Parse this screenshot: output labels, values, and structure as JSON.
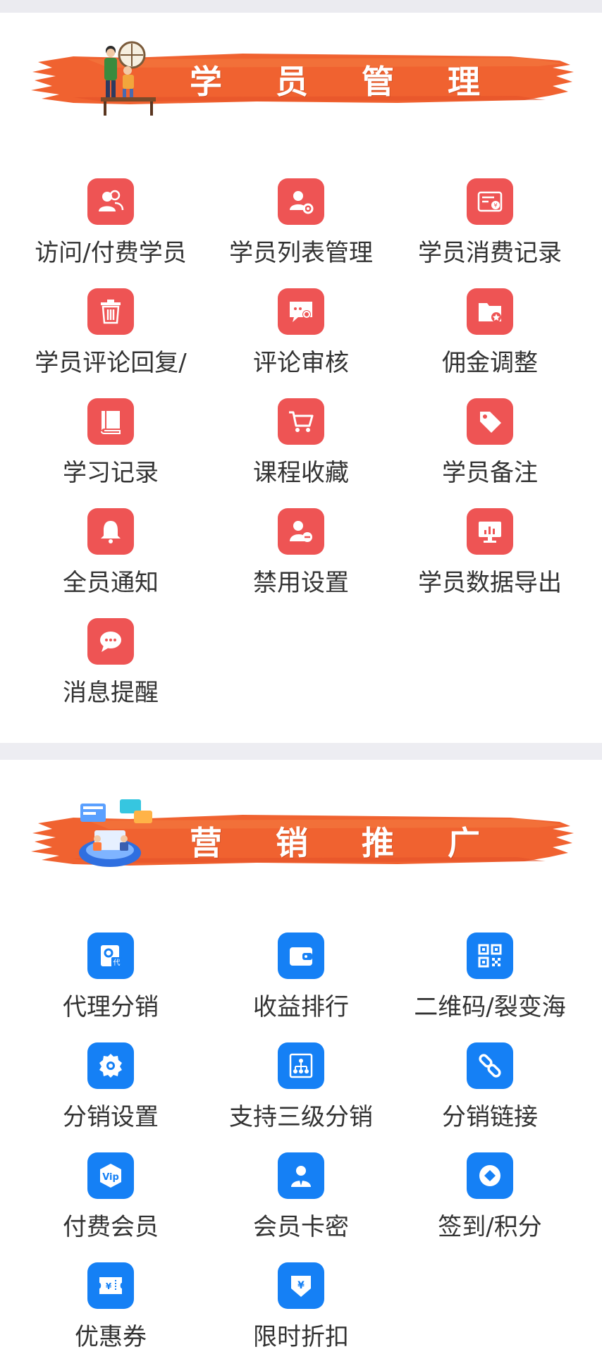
{
  "sections": [
    {
      "title": "学 员 管 理",
      "accent": "#ee5454",
      "items": [
        {
          "label": "访问/付费学员",
          "icon": "users-icon"
        },
        {
          "label": "学员列表管理",
          "icon": "user-settings-icon"
        },
        {
          "label": "学员消费记录",
          "icon": "bill-icon"
        },
        {
          "label": "学员评论回复/",
          "icon": "trash-icon"
        },
        {
          "label": "评论审核",
          "icon": "comment-review-icon"
        },
        {
          "label": "佣金调整",
          "icon": "folder-star-icon"
        },
        {
          "label": "学习记录",
          "icon": "book-icon"
        },
        {
          "label": "课程收藏",
          "icon": "cart-icon"
        },
        {
          "label": "学员备注",
          "icon": "tag-icon"
        },
        {
          "label": "全员通知",
          "icon": "bell-icon"
        },
        {
          "label": "禁用设置",
          "icon": "user-block-icon"
        },
        {
          "label": "学员数据导出",
          "icon": "monitor-chart-icon"
        },
        {
          "label": "消息提醒",
          "icon": "chat-icon"
        }
      ]
    },
    {
      "title": "营 销 推 广",
      "accent": "#1580f5",
      "items": [
        {
          "label": "代理分销",
          "icon": "agent-icon"
        },
        {
          "label": "收益排行",
          "icon": "wallet-icon"
        },
        {
          "label": "二维码/裂变海",
          "icon": "qrcode-icon"
        },
        {
          "label": "分销设置",
          "icon": "gear-icon"
        },
        {
          "label": "支持三级分销",
          "icon": "hierarchy-icon"
        },
        {
          "label": "分销链接",
          "icon": "link-icon"
        },
        {
          "label": "付费会员",
          "icon": "vip-icon"
        },
        {
          "label": "会员卡密",
          "icon": "member-card-icon"
        },
        {
          "label": "签到/积分",
          "icon": "points-icon"
        },
        {
          "label": "优惠券",
          "icon": "coupon-icon"
        },
        {
          "label": "限时折扣",
          "icon": "discount-icon"
        }
      ]
    }
  ]
}
